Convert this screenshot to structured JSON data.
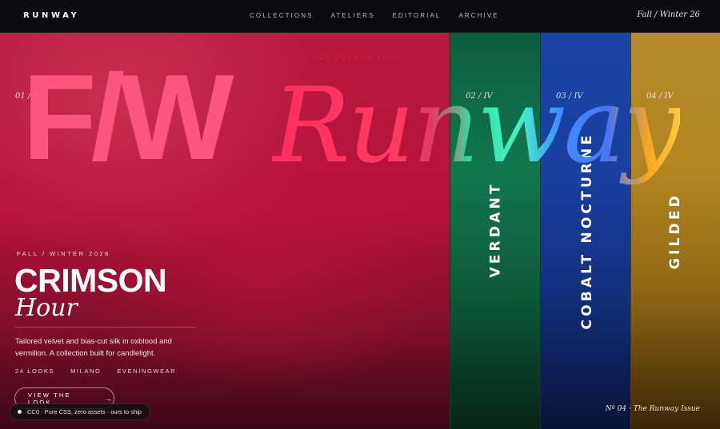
{
  "header": {
    "logo": "RUNWAY",
    "nav": [
      "COLLECTIONS",
      "ATELIERS",
      "EDITORIAL",
      "ARCHIVE"
    ],
    "season": "Fall / Winter 26"
  },
  "hero": {
    "kicker": "THE SEASON EDIT",
    "headline_a": "F/W",
    "headline_b": "Runway"
  },
  "panels": [
    {
      "num": "01 / IV",
      "name": "CRIMSON",
      "color": "#b8193f"
    },
    {
      "num": "02 / IV",
      "name": "VERDANT",
      "color": "#11774f"
    },
    {
      "num": "03 / IV",
      "name": "COBALT NOCTURNE",
      "color": "#1a3fa0"
    },
    {
      "num": "04 / IV",
      "name": "GILDED",
      "color": "#b2861f"
    }
  ],
  "feature": {
    "season_label": "FALL / WINTER 2026",
    "title_main": "CRIMSON",
    "title_sub": "Hour",
    "description": "Tailored velvet and bias-cut silk in oxblood and vermilion. A collection built for candlelight.",
    "meta": [
      "24 LOOKS",
      "MILANO",
      "EVENINGWEAR"
    ],
    "cta_label": "VIEW THE LOOK",
    "cta_icon": "arrow-right-icon"
  },
  "footer": {
    "badge": "CC0 · Pure CSS, zero assets · ours to ship",
    "issue": "Nº 04 · The Runway Issue"
  }
}
